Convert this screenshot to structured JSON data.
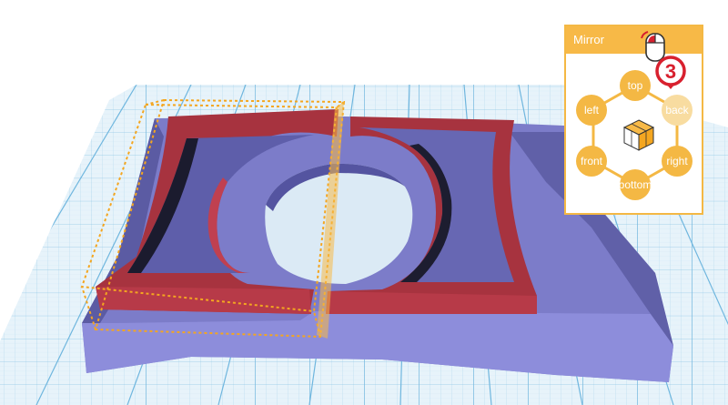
{
  "panel": {
    "title": "Mirror",
    "buttons": {
      "top": "top",
      "back": "back",
      "left": "left",
      "right": "right",
      "front": "front",
      "bottom": "bottom"
    },
    "active": "back",
    "step_number": "3"
  },
  "icons": {
    "mouse": "mouse-left-click-icon",
    "cube": "cube-orientation-icon"
  },
  "colors": {
    "accent": "#f4b844",
    "active_button": "#f8dca0",
    "badge": "#d8202e",
    "model_red": "#a7333f",
    "model_blue": "#7878c8",
    "grid": "#79bde0",
    "selection": "#f4a620"
  }
}
